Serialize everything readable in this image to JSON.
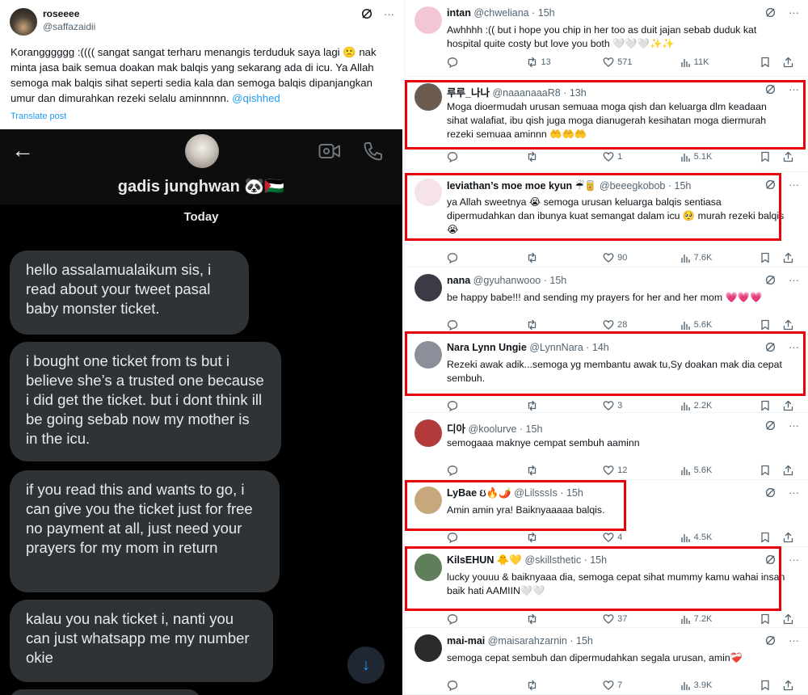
{
  "post": {
    "name": "roseeee",
    "handle": "@saffazaidii",
    "body": "Korangggggg :(((( sangat sangat terharu menangis terduduk saya lagi 🙁 nak minta jasa baik semua doakan mak balqis yang sekarang ada di icu. Ya Allah semoga mak balqis sihat seperti sedia kala dan semoga balqis dipanjangkan umur dan dimurahkan rezeki selalu aminnnnn.",
    "mention": "@qishhed",
    "translate": "Translate post"
  },
  "dm": {
    "name": "gadis junghwan 🐼🇵🇸",
    "date_label": "Today",
    "messages": [
      "hello assalamualaikum sis, i read about your tweet pasal baby monster ticket.",
      "i bought one ticket from ts but i believe she’s a trusted one because i did get the ticket. but i dont think ill be going sebab now my mother is in the icu.",
      "if you read this and wants to go, i can give you the ticket just for free no payment at all, just need your prayers for my mom in return",
      "kalau you nak ticket i, nanti you can just whatsapp me my number okie",
      ""
    ]
  },
  "replies": [
    {
      "name": "intan",
      "handle": "@chweliana",
      "time": "· 15h",
      "text": "Awhhhh :(( but i hope you chip in her too as duit jajan sebab duduk kat hospital quite costy but love you both 🤍🤍🤍✨✨",
      "replies": "",
      "reposts": "13",
      "likes": "571",
      "views": "11K",
      "avatar": "#f3c6d6"
    },
    {
      "name": "루루_나나",
      "handle": "@naaanaaaR8",
      "time": "· 13h",
      "text": "Moga dioermudah urusan semuaa moga qish dan keluarga dlm keadaan sihat walafiat, ibu qish juga moga dianugerah kesihatan moga diermurah rezeki semuaa aminnn 🤲🤲🤲",
      "replies": "",
      "reposts": "",
      "likes": "1",
      "views": "5.1K",
      "avatar": "#6b5a4e"
    },
    {
      "name": "leviathan’s moe moe kyun ☔🥫",
      "handle": "@beeegkobob",
      "time": "· 15h",
      "text": "ya Allah sweetnya 😭 semoga urusan keluarga balqis sentiasa dipermudahkan dan ibunya kuat semangat dalam icu 🥺 murah rezeki balqis 😭",
      "replies": "",
      "reposts": "",
      "likes": "90",
      "views": "7.6K",
      "avatar": "#f6e3e8"
    },
    {
      "name": "nana",
      "handle": "@gyuhanwooo",
      "time": "· 15h",
      "text": "be happy babe!!! and sending my prayers for her and her mom 💗💗💗",
      "replies": "",
      "reposts": "",
      "likes": "28",
      "views": "5.6K",
      "avatar": "#3b3a45"
    },
    {
      "name": "Nara Lynn Ungie",
      "handle": "@LynnNara",
      "time": "· 14h",
      "text": "Rezeki awak adik...semoga yg membantu awak tu,Sy doakan mak dia cepat sembuh.",
      "replies": "",
      "reposts": "",
      "likes": "3",
      "views": "2.2K",
      "avatar": "#8a8f99"
    },
    {
      "name": "디아",
      "handle": "@koolurve",
      "time": "· 15h",
      "text": "semogaaa maknye cempat sembuh aaminn",
      "replies": "",
      "reposts": "",
      "likes": "12",
      "views": "5.6K",
      "avatar": "#b23a3a"
    },
    {
      "name": "LyBae ઇ🔥🌶️",
      "handle": "@LilsssIs",
      "time": "· 15h",
      "text": "Amin amin yra! Baiknyaaaaa balqis.",
      "replies": "",
      "reposts": "",
      "likes": "4",
      "views": "4.5K",
      "avatar": "#c7a77c"
    },
    {
      "name": "KilsEHUN 🐥💛",
      "handle": "@skillsthetic",
      "time": "· 15h",
      "text": "lucky youuu & baiknyaaa dia, semoga cepat sihat mummy kamu wahai insan baik hati AAMIIN🤍🤍",
      "replies": "",
      "reposts": "",
      "likes": "37",
      "views": "7.2K",
      "avatar": "#5f7f5a"
    },
    {
      "name": "mai-mai",
      "handle": "@maisarahzarnin",
      "time": "· 15h",
      "text": "semoga cepat sembuh dan dipermudahkan segala urusan, amin❤️‍🩹",
      "replies": "",
      "reposts": "",
      "likes": "7",
      "views": "3.9K",
      "avatar": "#2b2b2b"
    }
  ]
}
